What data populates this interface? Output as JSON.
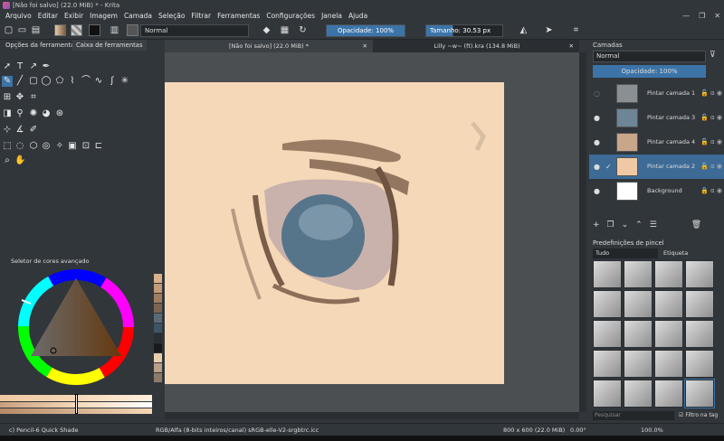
{
  "window": {
    "title": "[Não foi salvo]    (22.0 MiB) * - Krita"
  },
  "menu": [
    "Arquivo",
    "Editar",
    "Exibir",
    "Imagem",
    "Camada",
    "Seleção",
    "Filtrar",
    "Ferramentas",
    "Configurações",
    "Janela",
    "Ajuda"
  ],
  "toolbar": {
    "blend_mode": "Normal",
    "opacity": "Opacidade: 100%",
    "size": "Tamanho: 30.53 px"
  },
  "left_panel": {
    "tabs": [
      "Opções da ferramenta",
      "Caixa de ferramentas"
    ],
    "color_selector_title": "Seletor de cores avançado",
    "swatches": [
      "#d8b08a",
      "#c49a78",
      "#a07c60",
      "#7a6553",
      "#5a6b78",
      "#3e5566",
      "#2a2f33",
      "#1a1a1a",
      "#e8cfae",
      "#b9a088",
      "#8d7a68"
    ]
  },
  "document_tabs": [
    "[Não foi salvo]  (22.0 MiB) *",
    "Lilly ~w~ (ft).kra (134.8 MiB)"
  ],
  "layers_panel": {
    "title": "Camadas",
    "blend_mode": "Normal",
    "opacity": "Opacidade: 100%",
    "layers": [
      {
        "name": "Pintar camada 1",
        "visible": false,
        "selected": false
      },
      {
        "name": "Pintar camada 3",
        "visible": true,
        "selected": false
      },
      {
        "name": "Pintar camada 4",
        "visible": true,
        "selected": false
      },
      {
        "name": "Pintar camada 2",
        "visible": true,
        "selected": true
      },
      {
        "name": "Background",
        "visible": true,
        "selected": false
      }
    ]
  },
  "brush_panel": {
    "title": "Predefinições de pincel",
    "filter": "Tudo",
    "tag": "Etiqueta",
    "search_placeholder": "Pesquisar",
    "filter_in_tag": "Filtro na tag"
  },
  "status": {
    "brush": "c) Pencil-6 Quick Shade",
    "color_space": "RGB/Alfa (8-bits inteiros/canal)   sRGB-elle-V2-srgbtrc.icc",
    "image_size": "800 x 600 (22.0 MiB)",
    "rotation": "0.00°",
    "zoom": "100.0%"
  },
  "colors": {
    "accent": "#3c74a8",
    "selected_layer": "#3d6b96",
    "canvas": "#f5d8b8"
  }
}
